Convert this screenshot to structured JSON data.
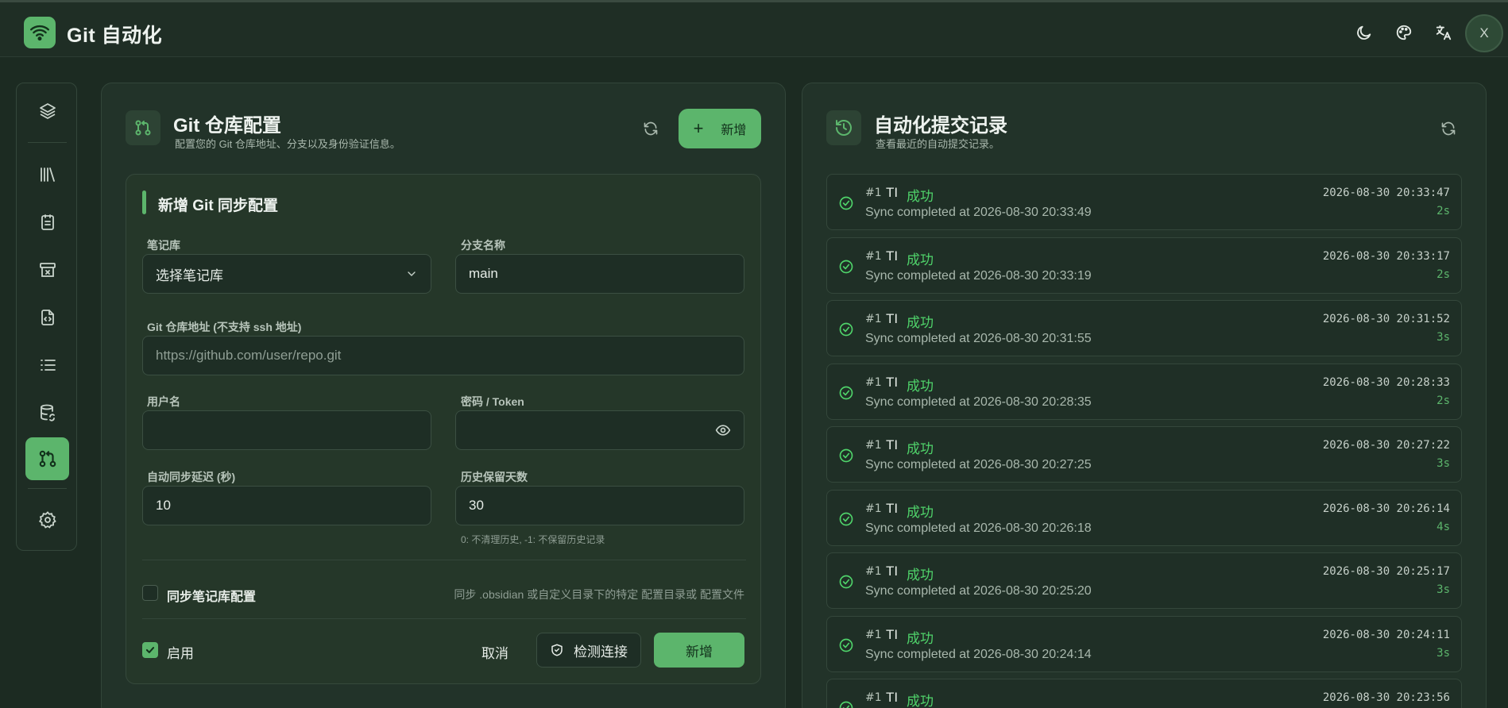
{
  "app": {
    "title": "Git 自动化",
    "avatar": "X"
  },
  "colors": {
    "accent": "#5cb56c",
    "success": "#4fd36a",
    "background": "#1c2b22"
  },
  "topbar_icons": [
    "moon-icon",
    "palette-icon",
    "translate-icon"
  ],
  "sidebar_icons": [
    "layers-icon",
    "library-icon",
    "notes-icon",
    "archive-icon",
    "file-code-icon",
    "list-icon",
    "database-sync-icon",
    "git-pull-request-icon",
    "settings-icon"
  ],
  "config": {
    "title": "Git 仓库配置",
    "subtitle": "配置您的 Git 仓库地址、分支以及身份验证信息。",
    "add_label": "新增",
    "form": {
      "heading": "新增 Git 同步配置",
      "vault_label": "笔记库",
      "vault_value": "选择笔记库",
      "branch_label": "分支名称",
      "branch_value": "main",
      "repo_label": "Git 仓库地址 (不支持 ssh 地址)",
      "repo_placeholder": "https://github.com/user/repo.git",
      "username_label": "用户名",
      "username_value": "",
      "password_label": "密码 / Token",
      "password_value": "",
      "delay_label": "自动同步延迟 (秒)",
      "delay_value": "10",
      "retention_label": "历史保留天数",
      "retention_value": "30",
      "retention_hint": "0: 不清理历史, -1: 不保留历史记录",
      "sync_config_label": "同步笔记库配置",
      "sync_config_checked": false,
      "sync_config_hint": "同步 .obsidian 或自定义目录下的特定 配置目录或 配置文件",
      "enable_label": "启用",
      "enable_checked": true,
      "cancel_label": "取消",
      "test_label": "检测连接",
      "submit_label": "新增"
    }
  },
  "commits": {
    "title": "自动化提交记录",
    "subtitle": "查看最近的自动提交记录。",
    "items": [
      {
        "num": "#1",
        "who": "TI",
        "status": "成功",
        "msg": "Sync completed at 2026-08-30 20:33:49",
        "time": "2026-08-30 20:33:47",
        "dur": "2s"
      },
      {
        "num": "#1",
        "who": "TI",
        "status": "成功",
        "msg": "Sync completed at 2026-08-30 20:33:19",
        "time": "2026-08-30 20:33:17",
        "dur": "2s"
      },
      {
        "num": "#1",
        "who": "TI",
        "status": "成功",
        "msg": "Sync completed at 2026-08-30 20:31:55",
        "time": "2026-08-30 20:31:52",
        "dur": "3s"
      },
      {
        "num": "#1",
        "who": "TI",
        "status": "成功",
        "msg": "Sync completed at 2026-08-30 20:28:35",
        "time": "2026-08-30 20:28:33",
        "dur": "2s"
      },
      {
        "num": "#1",
        "who": "TI",
        "status": "成功",
        "msg": "Sync completed at 2026-08-30 20:27:25",
        "time": "2026-08-30 20:27:22",
        "dur": "3s"
      },
      {
        "num": "#1",
        "who": "TI",
        "status": "成功",
        "msg": "Sync completed at 2026-08-30 20:26:18",
        "time": "2026-08-30 20:26:14",
        "dur": "4s"
      },
      {
        "num": "#1",
        "who": "TI",
        "status": "成功",
        "msg": "Sync completed at 2026-08-30 20:25:20",
        "time": "2026-08-30 20:25:17",
        "dur": "3s"
      },
      {
        "num": "#1",
        "who": "TI",
        "status": "成功",
        "msg": "Sync completed at 2026-08-30 20:24:14",
        "time": "2026-08-30 20:24:11",
        "dur": "3s"
      },
      {
        "num": "#1",
        "who": "TI",
        "status": "成功",
        "msg": "",
        "time": "2026-08-30 20:23:56",
        "dur": ""
      }
    ]
  }
}
